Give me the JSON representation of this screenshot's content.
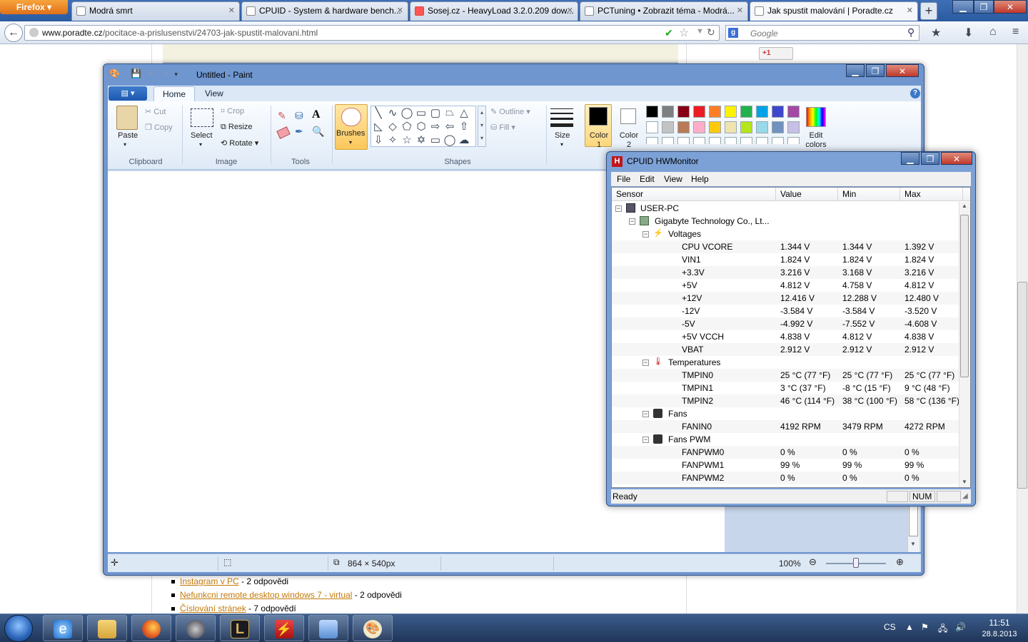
{
  "browser": {
    "menu_label": "Firefox",
    "tabs": [
      {
        "title": "Modrá smrt"
      },
      {
        "title": "CPUID - System & hardware bench..."
      },
      {
        "title": "Sosej.cz - HeavyLoad 3.2.0.209 dow..."
      },
      {
        "title": "PCTuning • Zobrazit téma - Modrá..."
      },
      {
        "title": "Jak spustit malování | Poradte.cz"
      }
    ],
    "url_domain": "www.poradte.cz",
    "url_path": "/pocitace-a-prislusenstvi/24703-jak-spustit-malovani.html",
    "search_placeholder": "Google",
    "gplus": "+1"
  },
  "page": {
    "links": [
      {
        "text": "Instagram v PC",
        "suffix": " - 2 odpovědi"
      },
      {
        "text": "Nefunkcni remote desktop windows 7 - virtual",
        "suffix": " - 2 odpovědi"
      },
      {
        "text": "Číslování stránek",
        "suffix": " - 7 odpovědí"
      }
    ]
  },
  "paint": {
    "title": "Untitled - Paint",
    "tabs": {
      "home": "Home",
      "view": "View"
    },
    "clipboard": {
      "paste": "Paste",
      "cut": "Cut",
      "copy": "Copy",
      "label": "Clipboard"
    },
    "image": {
      "select": "Select",
      "crop": "Crop",
      "resize": "Resize",
      "rotate": "Rotate",
      "label": "Image"
    },
    "tools": {
      "label": "Tools"
    },
    "brushes": "Brushes",
    "shapes": {
      "outline": "Outline",
      "fill": "Fill",
      "label": "Shapes"
    },
    "size": "Size",
    "color1": "Color 1",
    "color2": "Color 2",
    "edit_colors": "Edit colors",
    "palette_row1": [
      "#000000",
      "#7f7f7f",
      "#880015",
      "#ed1c24",
      "#ff7f27",
      "#fff200",
      "#22b14c",
      "#00a2e8",
      "#3f48cc",
      "#a349a4"
    ],
    "palette_row2": [
      "#ffffff",
      "#c3c3c3",
      "#b97a57",
      "#ffaec9",
      "#ffc90e",
      "#efe4b0",
      "#b5e61d",
      "#99d9ea",
      "#7092be",
      "#c8bfe7"
    ],
    "status": {
      "dimensions": "864 × 540px",
      "zoom": "100%"
    }
  },
  "hwmonitor": {
    "title": "CPUID HWMonitor",
    "menu": [
      "File",
      "Edit",
      "View",
      "Help"
    ],
    "columns": [
      "Sensor",
      "Value",
      "Min",
      "Max"
    ],
    "computer": "USER-PC",
    "board": "Gigabyte Technology Co., Lt...",
    "groups": {
      "voltages": "Voltages",
      "temperatures": "Temperatures",
      "fans": "Fans",
      "fans_pwm": "Fans PWM"
    },
    "voltages": [
      {
        "name": "CPU VCORE",
        "value": "1.344 V",
        "min": "1.344 V",
        "max": "1.392 V"
      },
      {
        "name": "VIN1",
        "value": "1.824 V",
        "min": "1.824 V",
        "max": "1.824 V"
      },
      {
        "name": "+3.3V",
        "value": "3.216 V",
        "min": "3.168 V",
        "max": "3.216 V"
      },
      {
        "name": "+5V",
        "value": "4.812 V",
        "min": "4.758 V",
        "max": "4.812 V"
      },
      {
        "name": "+12V",
        "value": "12.416 V",
        "min": "12.288 V",
        "max": "12.480 V"
      },
      {
        "name": "-12V",
        "value": "-3.584 V",
        "min": "-3.584 V",
        "max": "-3.520 V"
      },
      {
        "name": "-5V",
        "value": "-4.992 V",
        "min": "-7.552 V",
        "max": "-4.608 V"
      },
      {
        "name": "+5V VCCH",
        "value": "4.838 V",
        "min": "4.812 V",
        "max": "4.838 V"
      },
      {
        "name": "VBAT",
        "value": "2.912 V",
        "min": "2.912 V",
        "max": "2.912 V"
      }
    ],
    "temperatures": [
      {
        "name": "TMPIN0",
        "value": "25 °C  (77 °F)",
        "min": "25 °C  (77 °F)",
        "max": "25 °C  (77 °F)"
      },
      {
        "name": "TMPIN1",
        "value": "3 °C  (37 °F)",
        "min": "-8 °C  (15 °F)",
        "max": "9 °C  (48 °F)"
      },
      {
        "name": "TMPIN2",
        "value": "46 °C  (114 °F)",
        "min": "38 °C  (100 °F)",
        "max": "58 °C  (136 °F)"
      }
    ],
    "fans": [
      {
        "name": "FANIN0",
        "value": "4192 RPM",
        "min": "3479 RPM",
        "max": "4272 RPM"
      }
    ],
    "fans_pwm": [
      {
        "name": "FANPWM0",
        "value": "0 %",
        "min": "0 %",
        "max": "0 %"
      },
      {
        "name": "FANPWM1",
        "value": "99 %",
        "min": "99 %",
        "max": "99 %"
      },
      {
        "name": "FANPWM2",
        "value": "0 %",
        "min": "0 %",
        "max": "0 %"
      }
    ],
    "status": "Ready",
    "num": "NUM"
  },
  "taskbar": {
    "lang": "CS",
    "time": "11:51",
    "date": "28.8.2013"
  },
  "colors": {
    "accent": "#2a5aa0",
    "link": "#c27a0a"
  }
}
